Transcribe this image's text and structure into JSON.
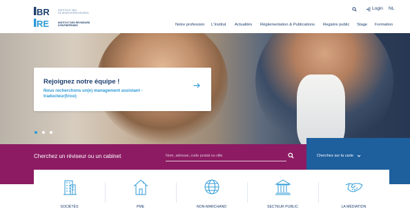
{
  "logo": {
    "line1": "Instituut van",
    "line2": "de Bedrijfsrevisoren",
    "line3": "Institut des Réviseurs",
    "line4": "d'Entreprises"
  },
  "utility": {
    "login_label": "Login",
    "language_label": "NL"
  },
  "nav": {
    "items": [
      {
        "label": "Notre profession"
      },
      {
        "label": "L'Institut"
      },
      {
        "label": "Actualités"
      },
      {
        "label": "Réglementation & Publications"
      },
      {
        "label": "Registre public"
      },
      {
        "label": "Stage"
      },
      {
        "label": "Formation"
      }
    ]
  },
  "hero": {
    "title": "Rejoignez notre équipe !",
    "subtitle": "Nous recherchons un(e) management assistant - traducteur(trice)",
    "active_slide": 1,
    "slide_count": 3
  },
  "search": {
    "label": "Cherchez un réviseur ou un cabinet",
    "placeholder": "Nom, adresse, code postal ou ville",
    "map_link": "Cherchez sur la carte"
  },
  "categories": [
    {
      "label": "Sociétés",
      "icon": "office-building-icon"
    },
    {
      "label": "PME",
      "icon": "house-icon"
    },
    {
      "label": "Non-marchand",
      "icon": "globe-icon"
    },
    {
      "label": "Secteur public",
      "icon": "government-building-icon"
    },
    {
      "label": "La médiation",
      "icon": "handshake-icon"
    }
  ],
  "colors": {
    "brand_navy": "#1c3f6e",
    "brand_accent": "#2d9ad6",
    "band_purple": "#8c1b63",
    "band_blue": "#1e5f9e"
  }
}
